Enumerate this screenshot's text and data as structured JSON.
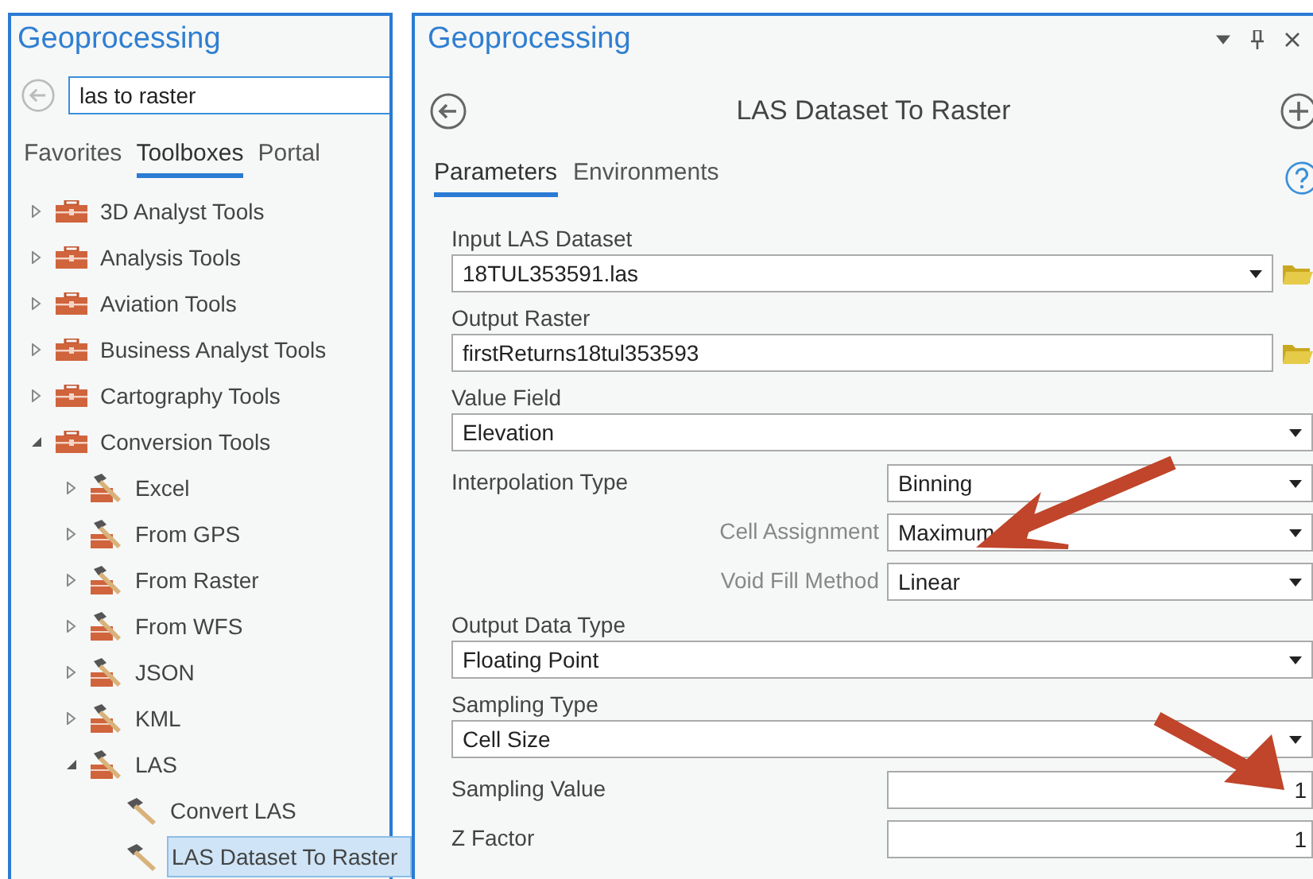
{
  "search_panel": {
    "title": "Geoprocessing",
    "search": {
      "value": "las to raster"
    },
    "tabs": [
      {
        "label": "Favorites",
        "selected": false
      },
      {
        "label": "Toolboxes",
        "selected": true
      },
      {
        "label": "Portal",
        "selected": false
      }
    ],
    "tree": [
      {
        "label": "3D Analyst Tools",
        "kind": "toolbox",
        "expanded": false,
        "selected": false
      },
      {
        "label": "Analysis Tools",
        "kind": "toolbox",
        "expanded": false,
        "selected": false
      },
      {
        "label": "Aviation Tools",
        "kind": "toolbox",
        "expanded": false,
        "selected": false
      },
      {
        "label": "Business Analyst Tools",
        "kind": "toolbox",
        "expanded": false,
        "selected": false
      },
      {
        "label": "Cartography Tools",
        "kind": "toolbox",
        "expanded": false,
        "selected": false
      },
      {
        "label": "Conversion Tools",
        "kind": "toolbox",
        "expanded": true,
        "selected": false,
        "children": [
          {
            "label": "Excel",
            "kind": "toolset",
            "expanded": false,
            "selected": false
          },
          {
            "label": "From GPS",
            "kind": "toolset",
            "expanded": false,
            "selected": false
          },
          {
            "label": "From Raster",
            "kind": "toolset",
            "expanded": false,
            "selected": false
          },
          {
            "label": "From WFS",
            "kind": "toolset",
            "expanded": false,
            "selected": false
          },
          {
            "label": "JSON",
            "kind": "toolset",
            "expanded": false,
            "selected": false
          },
          {
            "label": "KML",
            "kind": "toolset",
            "expanded": false,
            "selected": false
          },
          {
            "label": "LAS",
            "kind": "toolset",
            "expanded": true,
            "selected": false,
            "children": [
              {
                "label": "Convert LAS",
                "kind": "tool",
                "selected": false
              },
              {
                "label": "LAS Dataset To Raster",
                "kind": "tool",
                "selected": true
              }
            ]
          }
        ]
      }
    ]
  },
  "tool_panel": {
    "title": "Geoprocessing",
    "tool_title": "LAS Dataset To Raster",
    "tabs": [
      {
        "label": "Parameters",
        "selected": true
      },
      {
        "label": "Environments",
        "selected": false
      }
    ],
    "parameters": [
      {
        "label": "Input LAS Dataset",
        "value": "18TUL353591.las",
        "kind": "dropdown",
        "browse": true
      },
      {
        "label": "Output Raster",
        "value": "firstReturns18tul353593",
        "kind": "textbox",
        "browse": true
      },
      {
        "label": "Value Field",
        "value": "Elevation",
        "kind": "dropdown",
        "browse": false
      },
      {
        "label": "Interpolation Type",
        "value": "Binning",
        "kind": "choice",
        "browse": false
      },
      {
        "label": "Cell Assignment",
        "value": "Maximum",
        "kind": "suboption",
        "browse": false
      },
      {
        "label": "Void Fill Method",
        "value": "Linear",
        "kind": "suboption",
        "browse": false
      },
      {
        "label": "Output Data Type",
        "value": "Floating Point",
        "kind": "dropdown",
        "browse": false
      },
      {
        "label": "Sampling Type",
        "value": "Cell Size",
        "kind": "dropdown",
        "browse": false
      },
      {
        "label": "Sampling Value",
        "value": "1",
        "kind": "number",
        "browse": false
      },
      {
        "label": "Z Factor",
        "value": "1",
        "kind": "number",
        "browse": false
      }
    ]
  }
}
